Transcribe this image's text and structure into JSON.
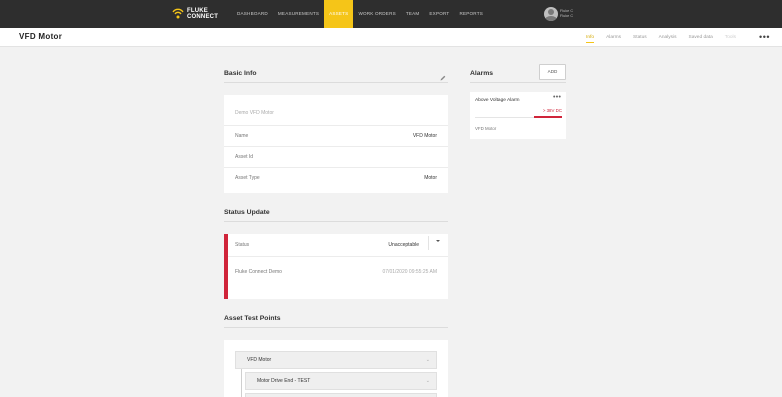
{
  "topbar": {
    "logo_line1": "FLUKE",
    "logo_line2": "CONNECT",
    "nav": [
      "DASHBOARD",
      "MEASUREMENTS",
      "ASSETS",
      "WORK ORDERS",
      "TEAM",
      "EXPORT",
      "REPORTS"
    ],
    "active_nav": "ASSETS",
    "user_line1": "Fluke C",
    "user_line2": "Fluke C"
  },
  "subheader": {
    "title": "VFD Motor",
    "tabs": [
      "Info",
      "Alarms",
      "Status",
      "Analysis",
      "Saved data",
      "Tools"
    ],
    "active_tab": "Info"
  },
  "basic_info": {
    "title": "Basic Info",
    "description": "Demo VFD Motor",
    "name_label": "Name",
    "name_value": "VFD Motor",
    "asset_id_label": "Asset Id",
    "asset_id_value": "",
    "asset_type_label": "Asset Type",
    "asset_type_value": "Motor"
  },
  "alarms": {
    "title": "Alarms",
    "add_label": "ADD",
    "items": [
      {
        "name": "Above Voltage Alarm",
        "threshold": "> 38V DC",
        "asset": "VFD Motor"
      }
    ]
  },
  "status_update": {
    "title": "Status Update",
    "status_label": "Status",
    "status_value": "Unacceptable",
    "source": "Fluke Connect Demo",
    "timestamp": "07/01/2020 09:55:25 AM"
  },
  "test_points": {
    "title": "Asset Test Points",
    "items": [
      {
        "label": "VFD Motor"
      },
      {
        "label": "Motor Drive End - TEST"
      }
    ]
  },
  "colors": {
    "accent": "#f5c518",
    "alert": "#d0243a",
    "nav_bg": "#2e2e2e"
  },
  "icons": [
    "edit-icon",
    "more-icon",
    "chevron-down-icon",
    "caret-down-icon"
  ]
}
